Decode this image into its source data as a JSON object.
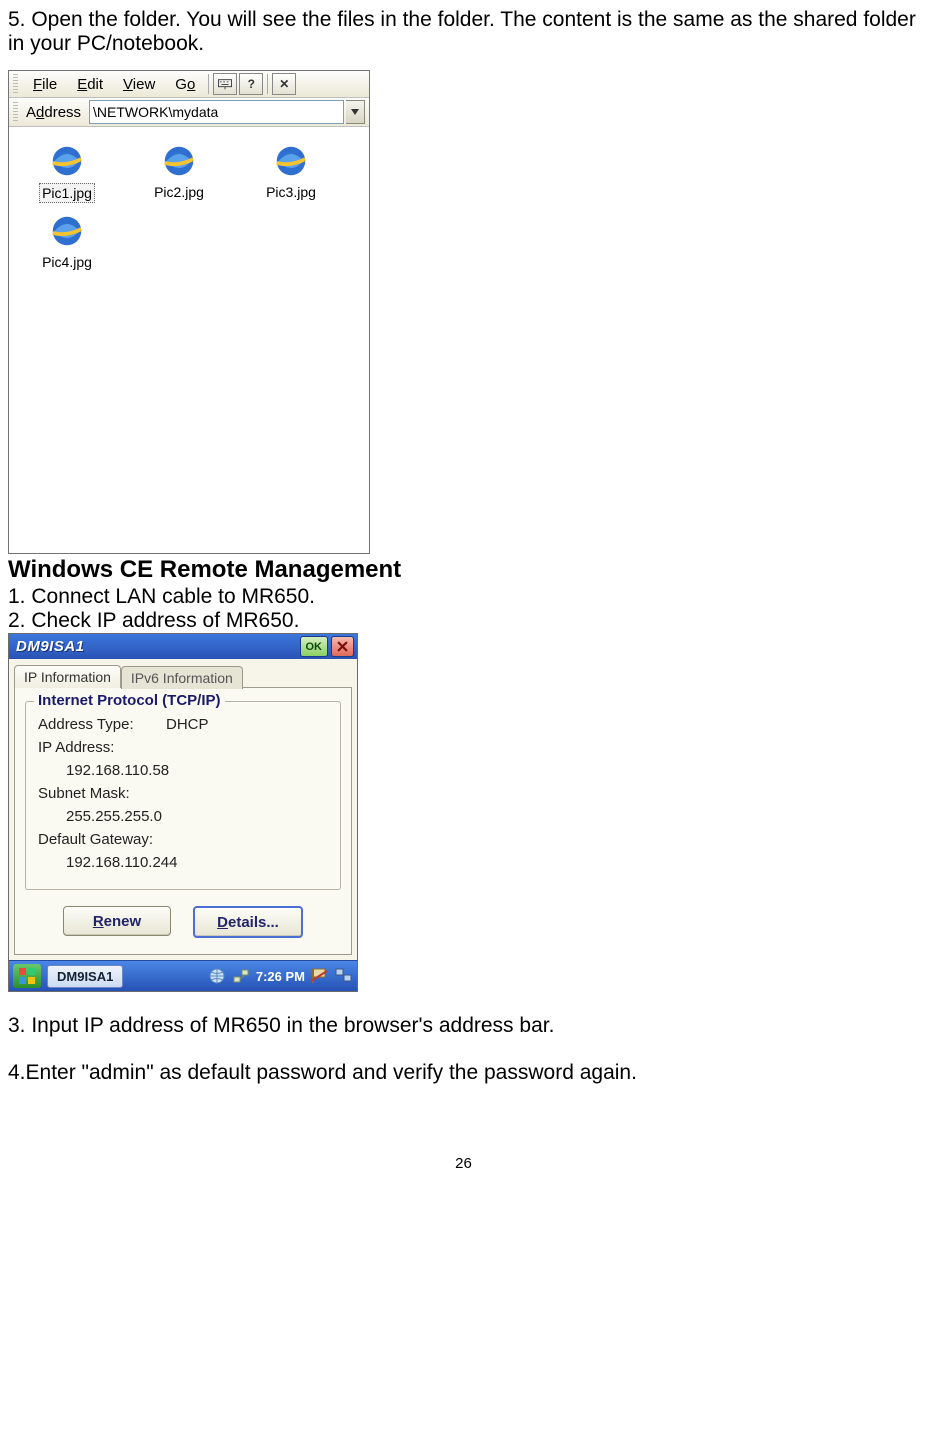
{
  "intro": "5. Open the folder. You will see the files in the folder. The content is the same as the shared folder in your PC/notebook.",
  "shot1": {
    "menu": {
      "file": "File",
      "edit": "Edit",
      "view": "View",
      "go": "Go"
    },
    "toolbar_help": "?",
    "toolbar_close": "✕",
    "address_label": "Address",
    "address_value": "\\NETWORK\\mydata",
    "files": [
      {
        "name": "Pic1.jpg",
        "selected": true
      },
      {
        "name": "Pic2.jpg",
        "selected": false
      },
      {
        "name": "Pic3.jpg",
        "selected": false
      },
      {
        "name": "Pic4.jpg",
        "selected": false
      }
    ]
  },
  "heading": "Windows CE Remote Management",
  "step1": "1. Connect LAN cable to MR650.",
  "step2": "2. Check IP address of MR650.",
  "shot2": {
    "title": "DM9ISA1",
    "ok": "OK",
    "tabs": {
      "t1": "IP Information",
      "t2": "IPv6 Information"
    },
    "group_title": "Internet Protocol (TCP/IP)",
    "rows": {
      "addr_type_k": "Address Type:",
      "addr_type_v": "DHCP",
      "ip_k": "IP Address:",
      "ip_v": "192.168.110.58",
      "mask_k": "Subnet Mask:",
      "mask_v": "255.255.255.0",
      "gw_k": "Default Gateway:",
      "gw_v": "192.168.110.244"
    },
    "btn_renew": "Renew",
    "btn_details": "Details...",
    "task_label": "DM9ISA1",
    "clock": "7:26 PM"
  },
  "step3": "3. Input IP address of MR650 in the browser's address bar.",
  "step4": "4.Enter \"admin\" as default password and verify the password again.",
  "page_no": "26"
}
